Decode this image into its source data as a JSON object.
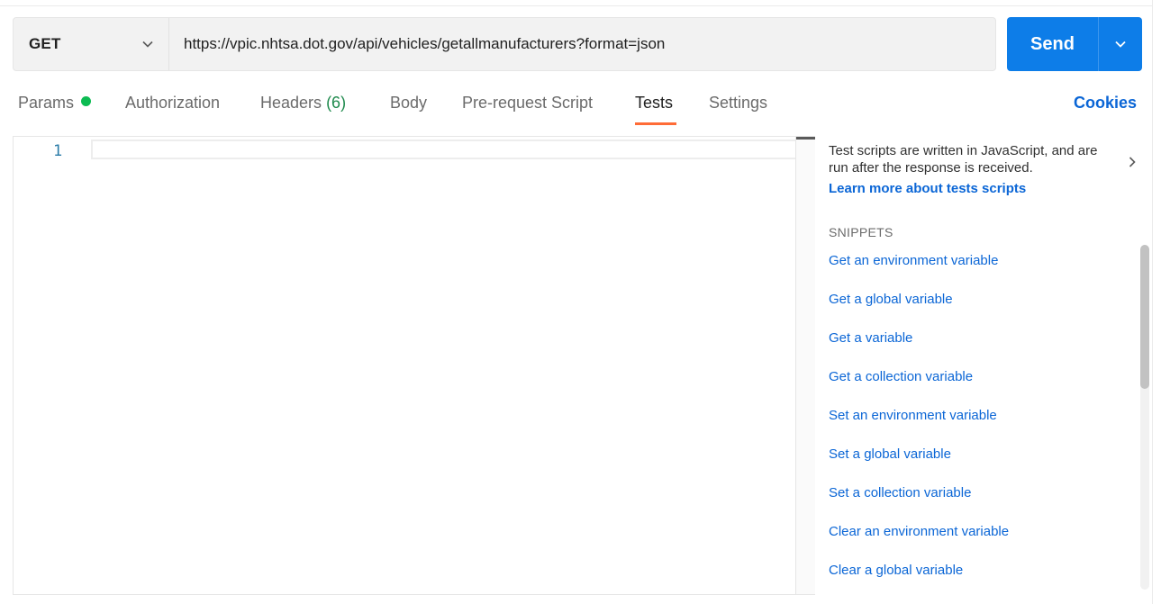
{
  "request": {
    "method": "GET",
    "url": "https://vpic.nhtsa.dot.gov/api/vehicles/getallmanufacturers?format=json",
    "send_label": "Send"
  },
  "tabs": {
    "params": "Params",
    "authorization": "Authorization",
    "headers": "Headers",
    "headers_count": "(6)",
    "body": "Body",
    "prerequest": "Pre-request Script",
    "tests": "Tests",
    "settings": "Settings",
    "active": "Tests"
  },
  "cookies_label": "Cookies",
  "editor": {
    "line_numbers": [
      "1"
    ],
    "content": ""
  },
  "side_panel": {
    "description": "Test scripts are written in JavaScript, and are run after the response is received.",
    "learn_more": "Learn more about tests scripts",
    "snippets_title": "SNIPPETS",
    "snippets": [
      "Get an environment variable",
      "Get a global variable",
      "Get a variable",
      "Get a collection variable",
      "Set an environment variable",
      "Set a global variable",
      "Set a collection variable",
      "Clear an environment variable",
      "Clear a global variable"
    ]
  },
  "colors": {
    "accent": "#0d7de8",
    "link": "#0b66d6",
    "active_tab_underline": "#ff6c37",
    "params_dot": "#0cbb52"
  }
}
